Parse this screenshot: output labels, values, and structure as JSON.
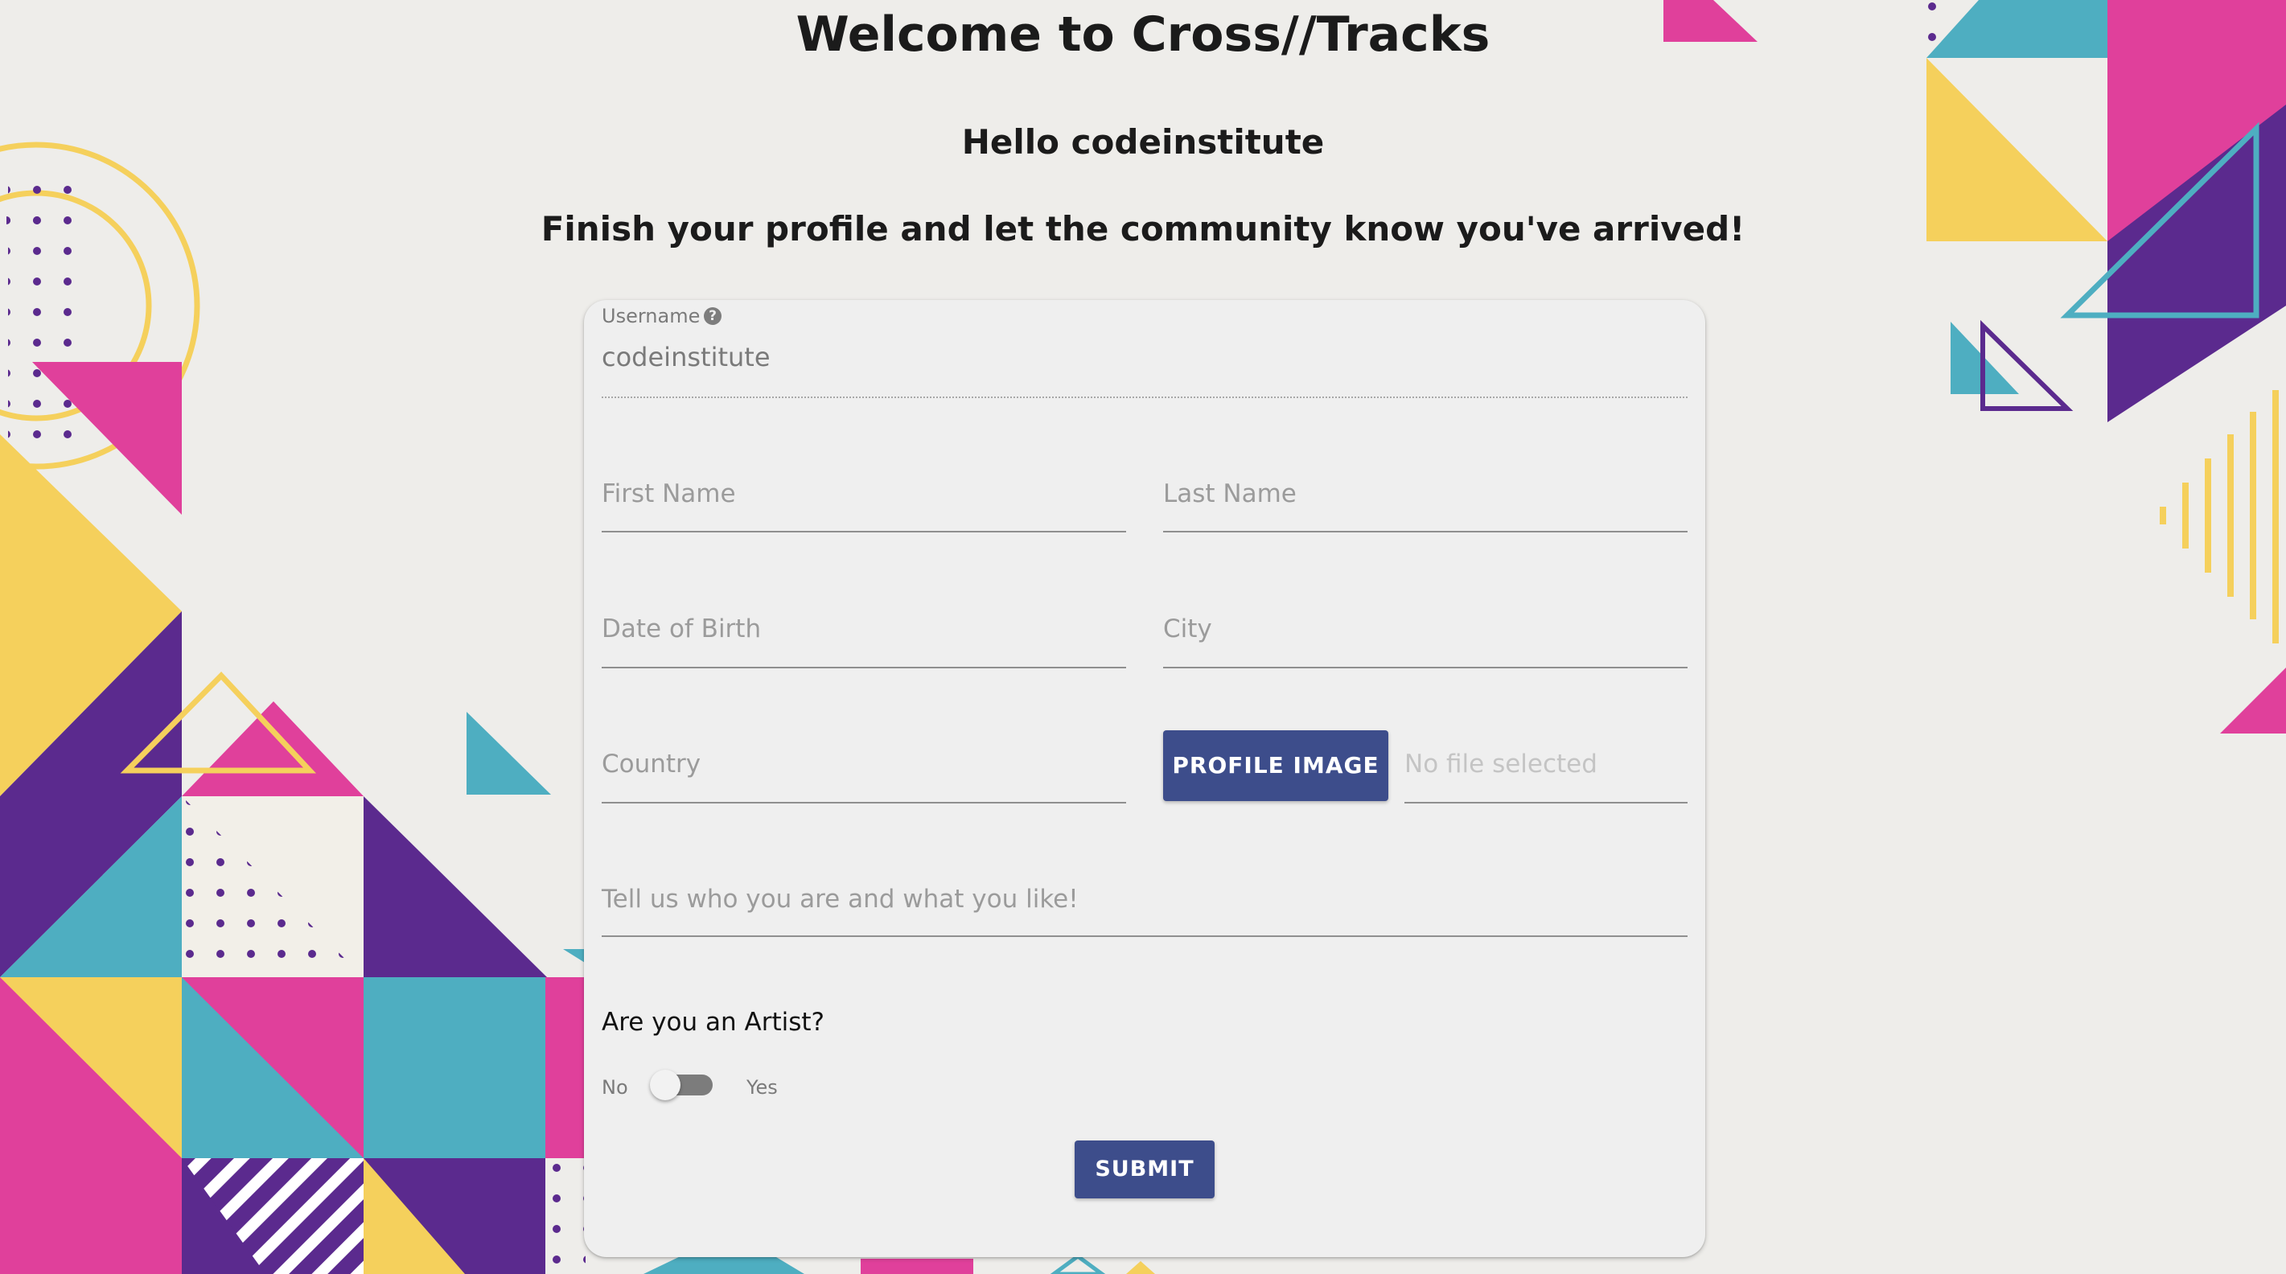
{
  "page": {
    "title": "Welcome to Cross//Tracks",
    "greeting": "Hello codeinstitute",
    "subtitle": "Finish your profile and let the community know you've arrived!"
  },
  "form": {
    "username": {
      "label": "Username",
      "value": "codeinstitute"
    },
    "first_name": {
      "placeholder": "First Name"
    },
    "last_name": {
      "placeholder": "Last Name"
    },
    "date_of_birth": {
      "placeholder": "Date of Birth"
    },
    "city": {
      "placeholder": "City"
    },
    "country": {
      "placeholder": "Country"
    },
    "profile_image": {
      "button_label": "PROFILE IMAGE",
      "status": "No file selected"
    },
    "bio": {
      "placeholder": "Tell us who you are and what you like!"
    },
    "artist": {
      "question": "Are you an Artist?",
      "off_label": "No",
      "on_label": "Yes",
      "value": false
    },
    "submit_label": "SUBMIT"
  },
  "colors": {
    "background": "#eeedea",
    "card": "#efefef",
    "button": "#3d4d8b",
    "pink": "#e0409b",
    "yellow": "#f5d05c",
    "purple": "#5b2a8e",
    "teal": "#4eaec1"
  }
}
